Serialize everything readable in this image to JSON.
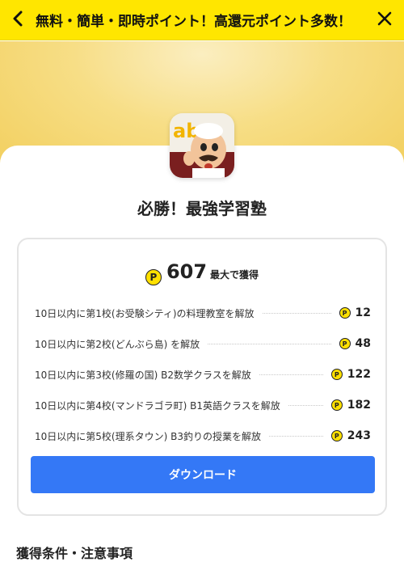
{
  "header": {
    "back_icon": "chevron-left-icon",
    "title": "無料・簡単・即時ポイント！高還元ポイント多数！",
    "close_icon": "close-icon",
    "bg_color": "#ffe600"
  },
  "app": {
    "icon": "app-icon-chef-character",
    "name": "必勝！最強学習塾"
  },
  "reward_card": {
    "coin_symbol": "P",
    "total_points": "607",
    "total_suffix": "最大で獲得",
    "tasks": [
      {
        "label": "10日以内に第1校(お受験シティ)の料理教室を解放",
        "points": "12"
      },
      {
        "label": "10日以内に第2校(どんぶら島) を解放",
        "points": "48"
      },
      {
        "label": "10日以内に第3校(修羅の国) B2数学クラスを解放",
        "points": "122"
      },
      {
        "label": "10日以内に第4校(マンドラゴラ町) B1英語クラスを解放",
        "points": "182"
      },
      {
        "label": "10日以内に第5校(理系タウン) B3釣りの授業を解放",
        "points": "243"
      }
    ],
    "download_label": "ダウンロード",
    "button_color": "#3478f6"
  },
  "conditions": {
    "title": "獲得条件・注意事項"
  }
}
